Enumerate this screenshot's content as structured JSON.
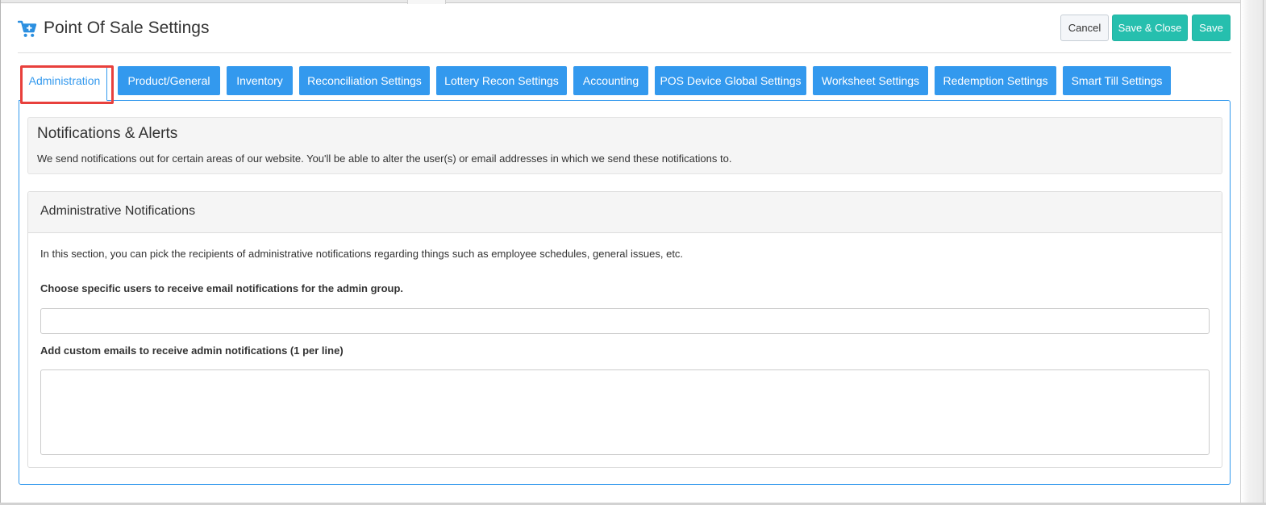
{
  "header": {
    "title": "Point Of Sale Settings",
    "icon": "cart-plus-icon",
    "cancel_label": "Cancel",
    "save_close_label": "Save & Close",
    "save_label": "Save"
  },
  "tabs": [
    {
      "label": "Administration",
      "active": true
    },
    {
      "label": "Product/General",
      "active": false
    },
    {
      "label": "Inventory",
      "active": false
    },
    {
      "label": "Reconciliation Settings",
      "active": false
    },
    {
      "label": "Lottery Recon Settings",
      "active": false
    },
    {
      "label": "Accounting",
      "active": false
    },
    {
      "label": "POS Device Global Settings",
      "active": false
    },
    {
      "label": "Worksheet Settings",
      "active": false
    },
    {
      "label": "Redemption Settings",
      "active": false
    },
    {
      "label": "Smart Till Settings",
      "active": false
    }
  ],
  "alerts": {
    "title": "Notifications & Alerts",
    "description": "We send notifications out for certain areas of our website. You'll be able to alter the user(s) or email addresses in which we send these notifications to."
  },
  "admin": {
    "title": "Administrative Notifications",
    "description": "In this section, you can pick the recipients of administrative notifications regarding things such as employee schedules, general issues, etc.",
    "users_label": "Choose specific users to receive email notifications for the admin group.",
    "users_value": "",
    "emails_label": "Add custom emails to receive admin notifications (1 per line)",
    "emails_value": ""
  },
  "colors": {
    "accent": "#3399ee",
    "save_button": "#26bfae",
    "highlight": "#e8403c"
  }
}
